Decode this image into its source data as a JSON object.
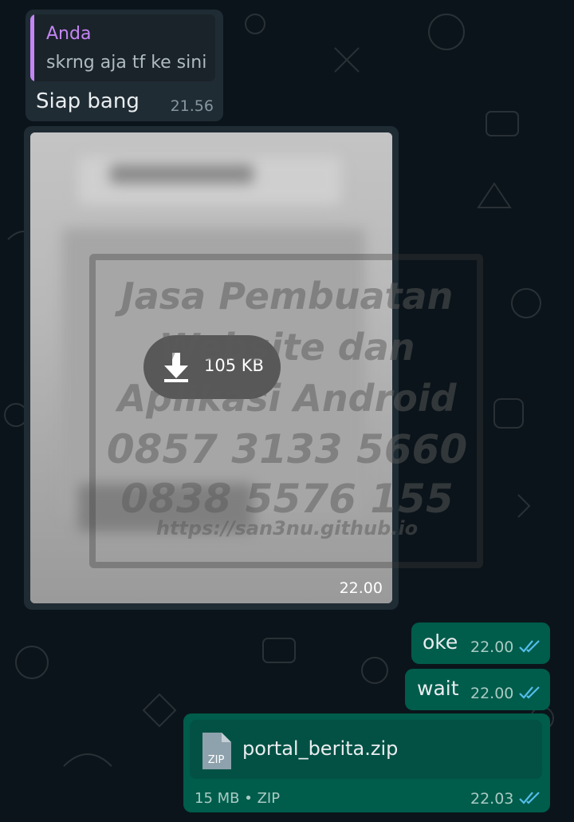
{
  "chat": {
    "reply_message": {
      "quote_author": "Anda",
      "quote_text": "skrng aja tf ke sini",
      "text": "Siap bang",
      "time": "21.56"
    },
    "image_message": {
      "size": "105 KB",
      "time": "22.00"
    },
    "outgoing": [
      {
        "text": "oke",
        "time": "22.00"
      },
      {
        "text": "wait",
        "time": "22.00"
      }
    ],
    "file_message": {
      "icon_label": "ZIP",
      "file_name": "portal_berita.zip",
      "meta": "15 MB • ZIP",
      "time": "22.03"
    }
  },
  "watermark": {
    "lines": [
      "Jasa Pembuatan",
      "Website dan",
      "Aplikasi Android",
      "0857 3133 5660",
      "0838 5576 155",
      "https://san3nu.github.io"
    ]
  },
  "colors": {
    "background": "#0b141a",
    "incoming_bubble": "#1f2c34",
    "outgoing_bubble": "#005c4b",
    "quote_accent": "#c485f5",
    "read_ticks": "#53bdeb"
  }
}
